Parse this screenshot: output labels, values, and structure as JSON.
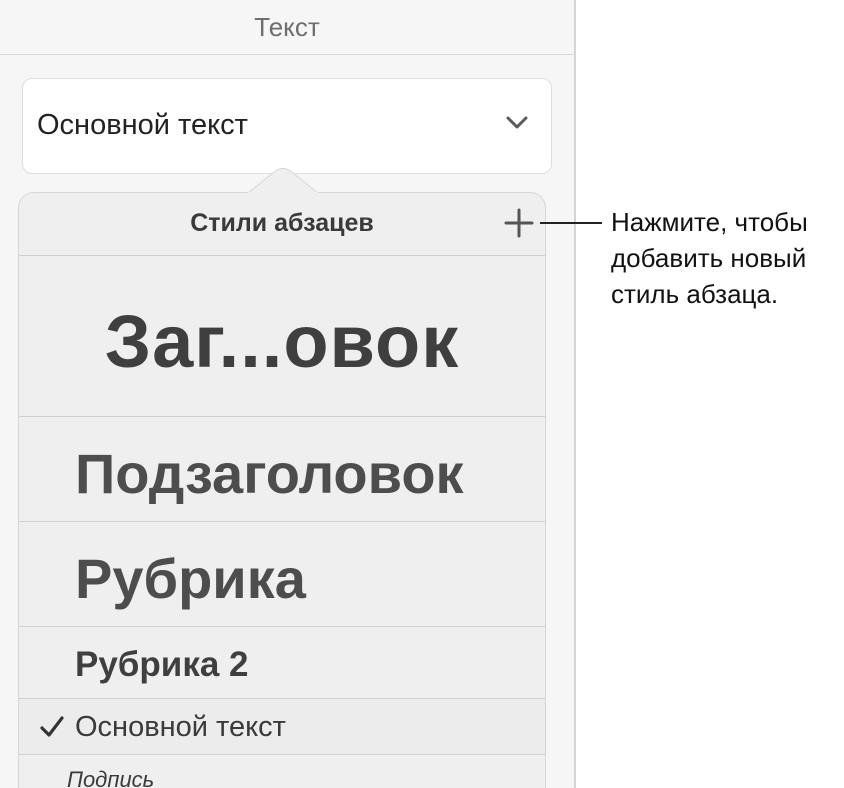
{
  "panel": {
    "header_title": "Текст",
    "style_select": {
      "value": "Основной текст",
      "chevron_icon": "chevron-down-icon"
    }
  },
  "popover": {
    "title": "Стили абзацев",
    "add_icon": "plus-icon",
    "styles": [
      {
        "label": "Заг...овок",
        "selected": false
      },
      {
        "label": "Подзаголовок",
        "selected": false
      },
      {
        "label": "Рубрика",
        "selected": false
      },
      {
        "label": "Рубрика 2",
        "selected": false
      },
      {
        "label": "Основной текст",
        "selected": true
      },
      {
        "label": "Подпись",
        "selected": false
      }
    ],
    "checkmark_icon": "checkmark-icon"
  },
  "callout": {
    "lines": [
      "Нажмите, чтобы",
      "добавить новый",
      "стиль абзаца."
    ]
  },
  "colors": {
    "panel_bg": "#f6f6f6",
    "popover_bg": "#efefef",
    "text_dark": "#3a3a3a",
    "divider": "#d0d0d0"
  }
}
